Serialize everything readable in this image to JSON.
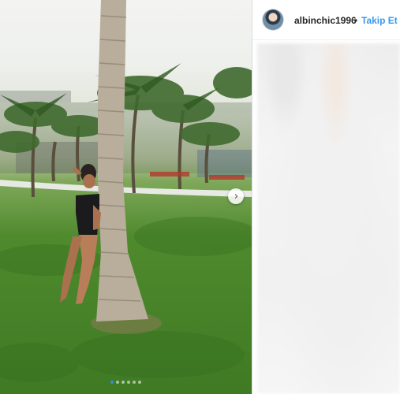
{
  "post": {
    "username": "albinchic1996",
    "separator": "•",
    "follow_label": "Takip Et",
    "accent_color": "#3897f0",
    "carousel": {
      "total_slides": 6,
      "active_index": 0,
      "next_icon": "chevron-right-icon",
      "next_glyph": "›"
    }
  }
}
